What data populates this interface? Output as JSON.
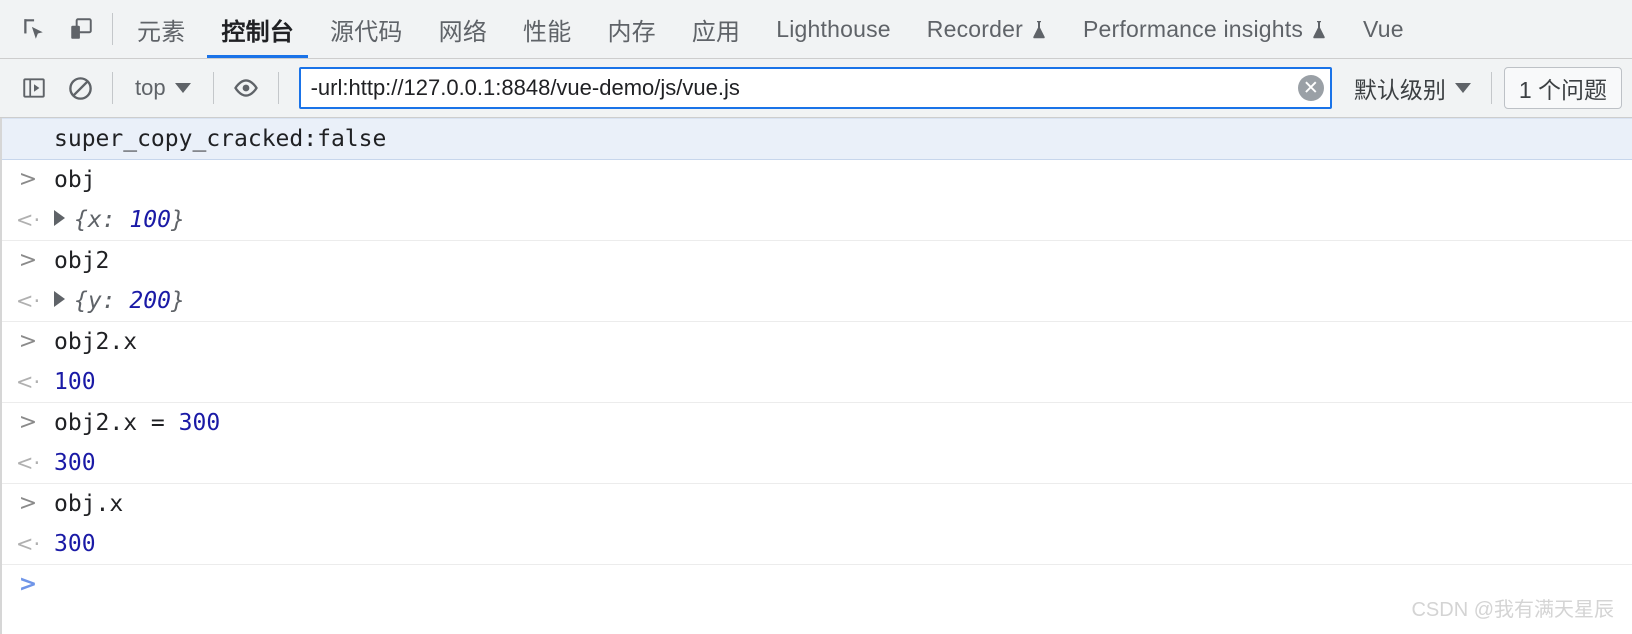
{
  "tabbar": {
    "inspect_icon": "inspect-element-icon",
    "device_icon": "device-toolbar-icon",
    "tabs": [
      {
        "label": "元素",
        "active": false,
        "experimental": false,
        "cn": true
      },
      {
        "label": "控制台",
        "active": true,
        "experimental": false,
        "cn": true
      },
      {
        "label": "源代码",
        "active": false,
        "experimental": false,
        "cn": true
      },
      {
        "label": "网络",
        "active": false,
        "experimental": false,
        "cn": true
      },
      {
        "label": "性能",
        "active": false,
        "experimental": false,
        "cn": true
      },
      {
        "label": "内存",
        "active": false,
        "experimental": false,
        "cn": true
      },
      {
        "label": "应用",
        "active": false,
        "experimental": false,
        "cn": true
      },
      {
        "label": "Lighthouse",
        "active": false,
        "experimental": false,
        "cn": false
      },
      {
        "label": "Recorder",
        "active": false,
        "experimental": true,
        "cn": false
      },
      {
        "label": "Performance insights",
        "active": false,
        "experimental": true,
        "cn": false
      },
      {
        "label": "Vue",
        "active": false,
        "experimental": false,
        "cn": false
      }
    ],
    "accent_color": "#1a73e8"
  },
  "console_toolbar": {
    "sidebar_toggle_icon": "console-sidebar-icon",
    "clear_icon": "clear-console-icon",
    "context": "top",
    "eye_icon": "live-expression-eye-icon",
    "filter_value": "-url:http://127.0.0.1:8848/vue-demo/js/vue.js",
    "filter_placeholder": "过滤",
    "clear_filter_icon": "clear-input-icon",
    "level": "默认级别",
    "issues": "1 个问题"
  },
  "console": {
    "rows": [
      {
        "kind": "message",
        "gutter": "",
        "text": "super_copy_cracked:false"
      },
      {
        "kind": "input",
        "gutter": ">",
        "text": "obj"
      },
      {
        "kind": "object",
        "gutter": "<·",
        "prefix": "{",
        "key": "x: ",
        "value": "100",
        "suffix": "}",
        "group_end": true
      },
      {
        "kind": "input",
        "gutter": ">",
        "text": "obj2"
      },
      {
        "kind": "object",
        "gutter": "<·",
        "prefix": "{",
        "key": "y: ",
        "value": "200",
        "suffix": "}",
        "group_end": true
      },
      {
        "kind": "input",
        "gutter": ">",
        "text": "obj2.x"
      },
      {
        "kind": "result",
        "gutter": "<·",
        "text": "100",
        "group_end": true
      },
      {
        "kind": "input-expr",
        "gutter": ">",
        "text": "obj2.x = ",
        "value": "300"
      },
      {
        "kind": "result",
        "gutter": "<·",
        "text": "300",
        "group_end": true
      },
      {
        "kind": "input",
        "gutter": ">",
        "text": "obj.x"
      },
      {
        "kind": "result",
        "gutter": "<·",
        "text": "300",
        "group_end": true
      },
      {
        "kind": "prompt",
        "gutter": ">",
        "text": ""
      }
    ]
  },
  "watermark": "CSDN @我有满天星辰"
}
